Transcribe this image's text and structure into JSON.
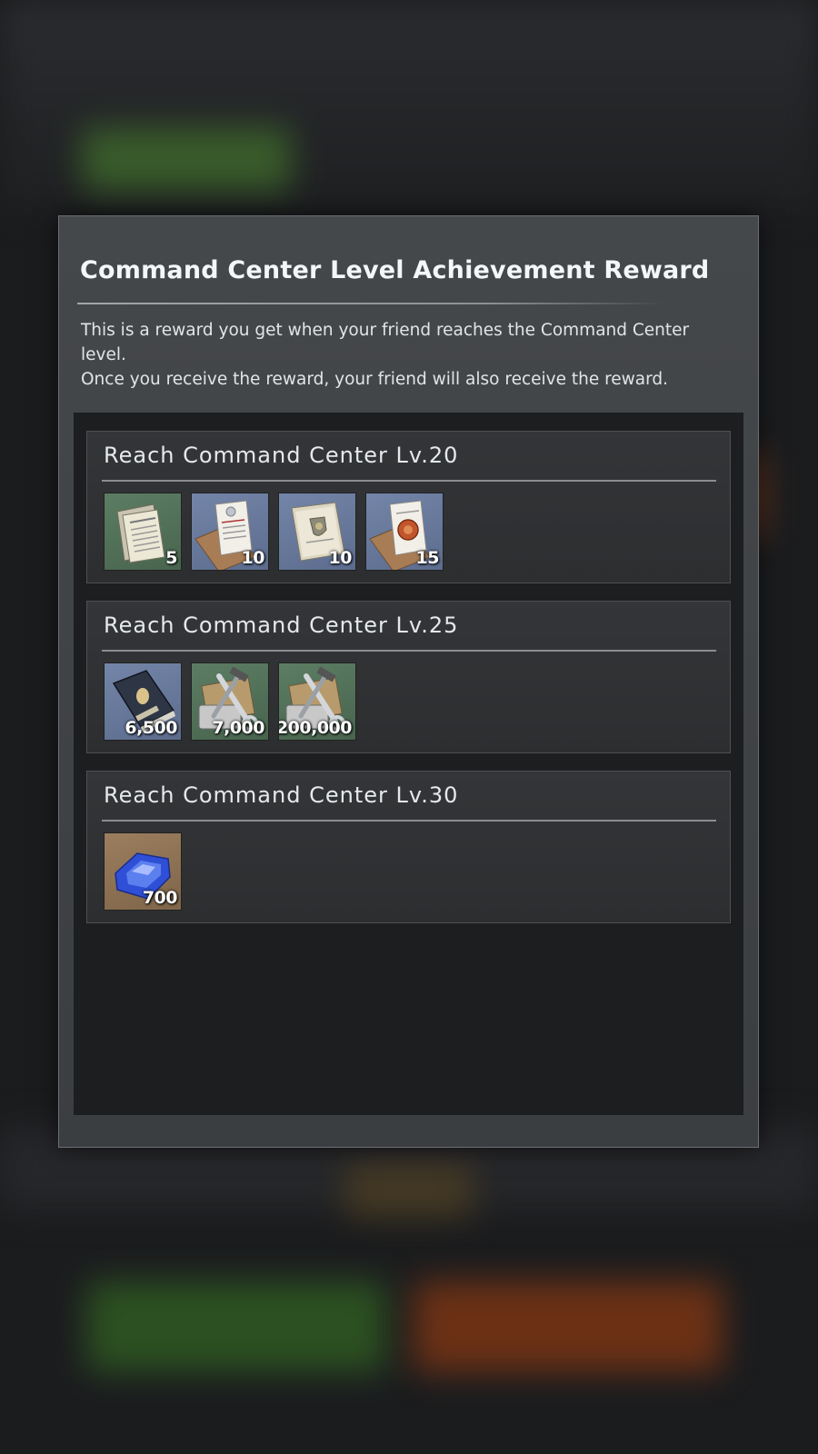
{
  "dialog": {
    "title": "Command Center Level Achievement Reward",
    "description_line1": "This is a reward you get when your friend reaches the Command Center level.",
    "description_line2": "Once you receive the reward, your friend will also receive the reward."
  },
  "milestones": [
    {
      "label": "Reach Command Center Lv.20",
      "items": [
        {
          "icon": "newspaper-icon",
          "quantity": "5"
        },
        {
          "icon": "document-envelope-icon",
          "quantity": "10"
        },
        {
          "icon": "certificate-icon",
          "quantity": "10"
        },
        {
          "icon": "sealed-letter-icon",
          "quantity": "15"
        }
      ]
    },
    {
      "label": "Reach Command Center Lv.25",
      "items": [
        {
          "icon": "manual-book-icon",
          "quantity": "6,500"
        },
        {
          "icon": "tools-icon",
          "quantity": "7,000"
        },
        {
          "icon": "tools-icon",
          "quantity": "200,000"
        }
      ]
    },
    {
      "label": "Reach Command Center Lv.30",
      "items": [
        {
          "icon": "blue-gem-icon",
          "quantity": "700"
        }
      ]
    }
  ]
}
